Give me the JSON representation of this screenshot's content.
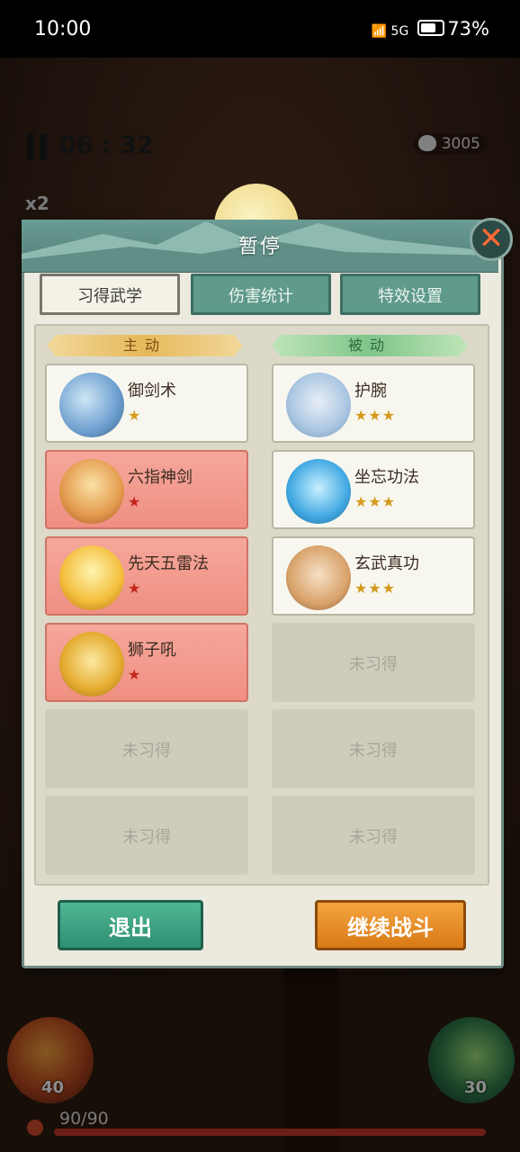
{
  "status_bar": {
    "time": "10:00",
    "network": "5G",
    "battery": "73%"
  },
  "hud": {
    "timer": "06 : 32",
    "coins": "3005",
    "speed": "x2"
  },
  "footer": {
    "left_skill_count": "40",
    "right_skill_count": "30",
    "hp": "90/90",
    "hp_ratio": 1.0
  },
  "dialog": {
    "title": "暂停",
    "tabs": [
      {
        "label": "习得武学",
        "active": true
      },
      {
        "label": "伤害统计",
        "active": false
      },
      {
        "label": "特效设置",
        "active": false
      }
    ],
    "columns": {
      "active": {
        "title": "主动",
        "skills": [
          {
            "name": "御剑术",
            "stars": "★",
            "style": "white",
            "icon": "flying-sword-icon"
          },
          {
            "name": "六指神剑",
            "stars": "★",
            "style": "red",
            "icon": "crystal-sword-icon"
          },
          {
            "name": "先天五雷法",
            "stars": "★",
            "style": "red",
            "icon": "lightning-icon"
          },
          {
            "name": "狮子吼",
            "stars": "★",
            "style": "red",
            "icon": "lion-roar-icon"
          },
          {
            "name": "",
            "empty_label": "未习得",
            "style": "empty"
          },
          {
            "name": "",
            "empty_label": "未习得",
            "style": "empty"
          }
        ]
      },
      "passive": {
        "title": "被动",
        "skills": [
          {
            "name": "护腕",
            "stars": "★★★",
            "style": "white",
            "icon": "bracer-icon"
          },
          {
            "name": "坐忘功法",
            "stars": "★★★",
            "style": "white",
            "icon": "meditation-icon"
          },
          {
            "name": "玄武真功",
            "stars": "★★★",
            "style": "white",
            "icon": "warrior-icon"
          },
          {
            "name": "",
            "empty_label": "未习得",
            "style": "empty"
          },
          {
            "name": "",
            "empty_label": "未习得",
            "style": "empty"
          },
          {
            "name": "",
            "empty_label": "未习得",
            "style": "empty"
          }
        ]
      }
    },
    "buttons": {
      "exit": "退出",
      "continue": "继续战斗"
    }
  }
}
